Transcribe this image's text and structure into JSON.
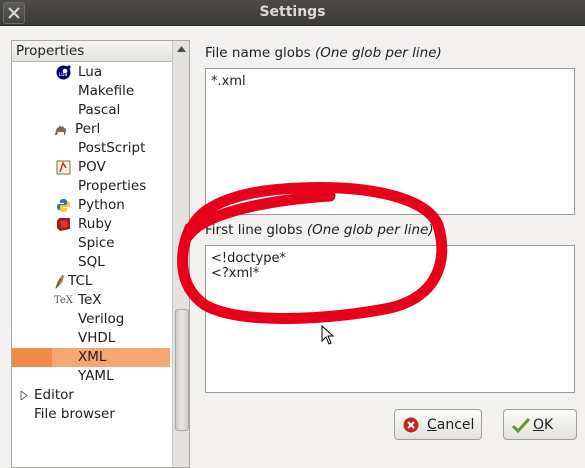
{
  "window": {
    "title": "Settings",
    "close_icon": "close-icon"
  },
  "tree": {
    "header": "Properties",
    "items": [
      {
        "label": "Lua",
        "icon": "lua-icon"
      },
      {
        "label": "Makefile",
        "icon": ""
      },
      {
        "label": "Pascal",
        "icon": ""
      },
      {
        "label": "Perl",
        "icon": "perl-camel-icon"
      },
      {
        "label": "PostScript",
        "icon": ""
      },
      {
        "label": "POV",
        "icon": "pov-icon"
      },
      {
        "label": "Properties",
        "icon": ""
      },
      {
        "label": "Python",
        "icon": "python-icon"
      },
      {
        "label": "Ruby",
        "icon": "ruby-icon"
      },
      {
        "label": "Spice",
        "icon": ""
      },
      {
        "label": "SQL",
        "icon": ""
      },
      {
        "label": "TCL",
        "icon": "tcl-feather-icon"
      },
      {
        "label": "TeX",
        "icon": "tex-icon"
      },
      {
        "label": "Verilog",
        "icon": ""
      },
      {
        "label": "VHDL",
        "icon": ""
      },
      {
        "label": "XML",
        "icon": "",
        "selected": true
      },
      {
        "label": "YAML",
        "icon": ""
      },
      {
        "label": "Editor",
        "icon": "expander-arrow-icon"
      },
      {
        "label": "File browser",
        "icon": ""
      }
    ],
    "tex_logo_text": "TeX"
  },
  "file_name_globs": {
    "label": "File name globs",
    "hint": "(One glob per line)",
    "value": "*.xml"
  },
  "first_line_globs": {
    "label": "First line globs",
    "hint": "(One glob per line)",
    "value": "<!doctype*\n<?xml*"
  },
  "buttons": {
    "cancel": {
      "label_u": "C",
      "label_rest": "ancel",
      "icon": "cancel-icon"
    },
    "ok": {
      "label_u": "O",
      "label_rest": "K",
      "icon": "checkmark-icon"
    }
  },
  "colors": {
    "selection": "#f4a775",
    "annotation": "#e8001a",
    "titlebar": "#3c3b37"
  }
}
